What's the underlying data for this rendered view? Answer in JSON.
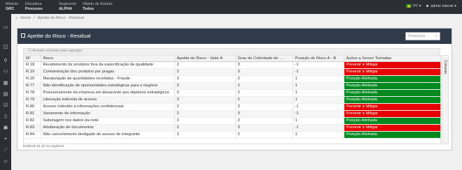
{
  "topbar": {
    "filters": [
      {
        "label": "Módulo",
        "value": "GRC"
      },
      {
        "label": "Disciplina",
        "value": "Processo"
      },
      {
        "label": "Segmento",
        "value": "ALPHA"
      },
      {
        "label": "Objeto de Estudo",
        "value": "Todos"
      }
    ],
    "language": "PT",
    "user": "admin intersk"
  },
  "breadcrumb": {
    "home": "Home",
    "current": "Apetite do Risco - Residual"
  },
  "panel": {
    "title": "Apetite do Risco - Residual",
    "search_placeholder": "Pesquisar ...",
    "group_hint": "Arraste colunas para agrupar",
    "columns_label": "Colunas",
    "footer": "Exibindo 51 de 51 registros."
  },
  "table": {
    "headers": [
      "Nº",
      "Risco",
      "Apetite de Risco - Valor A",
      "Grau de Criticidade do ...",
      "Posição do Risco A - B",
      "Ações a Serem Tomadas"
    ],
    "rows": [
      {
        "n": "R.18",
        "risco": "Recebimento de produtos fora da especificação de qualidade",
        "apetite": "2",
        "grau": "3",
        "posicao": "-1",
        "acao": "Prevenir e Mitigar",
        "status": "red"
      },
      {
        "n": "R.19",
        "risco": "Contaminação dos produtos por pragas",
        "apetite": "2",
        "grau": "3",
        "posicao": "-1",
        "acao": "Prevenir e Mitigar",
        "status": "red"
      },
      {
        "n": "R.20",
        "risco": "Manipulação de quantidades recebidas - Fraude",
        "apetite": "3",
        "grau": "2",
        "posicao": "1",
        "acao": "Posição Alinhada",
        "status": "green"
      },
      {
        "n": "R.77",
        "risco": "Não identificação de oportunidades estratégicas para o negócio",
        "apetite": "3",
        "grau": "2",
        "posicao": "1",
        "acao": "Posição Alinhada",
        "status": "green"
      },
      {
        "n": "R.78",
        "risco": "Posicionamento da empresa em desacordo aos objetivos estratégicos",
        "apetite": "3",
        "grau": "2",
        "posicao": "1",
        "acao": "Posição Alinhada",
        "status": "green"
      },
      {
        "n": "R.79",
        "risco": "Liberação indevida de acesso",
        "apetite": "3",
        "grau": "2",
        "posicao": "1",
        "acao": "Posição Alinhada",
        "status": "green"
      },
      {
        "n": "R.80",
        "risco": "Acesso indevido a informações confidenciais",
        "apetite": "2",
        "grau": "3",
        "posicao": "-1",
        "acao": "Prevenir e Mitigar",
        "status": "red"
      },
      {
        "n": "R.81",
        "risco": "Vazamento de informação",
        "apetite": "2",
        "grau": "3",
        "posicao": "-1",
        "acao": "Prevenir e Mitigar",
        "status": "red"
      },
      {
        "n": "R.82",
        "risco": "Sabotagem nos dados da rede",
        "apetite": "3",
        "grau": "2",
        "posicao": "1",
        "acao": "Posição Alinhada",
        "status": "green"
      },
      {
        "n": "R.83",
        "risco": "Adulteração de documentos",
        "apetite": "2",
        "grau": "3",
        "posicao": "-1",
        "acao": "Prevenir e Mitigar",
        "status": "red"
      },
      {
        "n": "R.84",
        "risco": "Não cancelamento desligado de acesso de integrante",
        "apetite": "3",
        "grau": "2",
        "posicao": "1",
        "acao": "Posição Alinhada",
        "status": "green"
      }
    ]
  },
  "sidebar_icons": [
    "folder-icon",
    "dashboard-icon",
    "org-chart-icon",
    "users-icon",
    "grid-icon",
    "book-icon",
    "checklist-icon",
    "document-icon",
    "calendar-icon",
    "map-pin-icon",
    "chart-icon",
    "folder-open-icon"
  ]
}
